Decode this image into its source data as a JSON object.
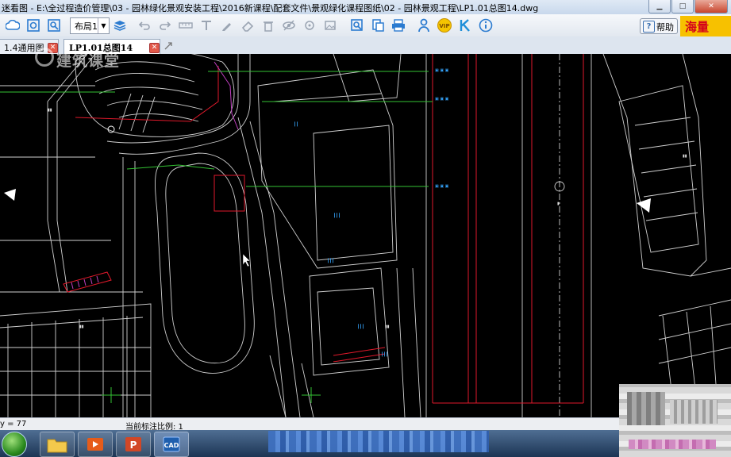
{
  "window": {
    "title": "迷看图 - E:\\全过程造价管理\\03 - 园林绿化景观安装工程\\2016新课程\\配套文件\\景观绿化课程图纸\\02 - 园林景观工程\\LP1.01总图14.dwg"
  },
  "toolbar": {
    "layout_value": "布局1",
    "help_label": "帮助",
    "ad_text": "海量"
  },
  "tabs": [
    {
      "label": "1.4通用图"
    },
    {
      "label": "LP1.01总图14"
    }
  ],
  "watermark": {
    "text": "建筑课堂"
  },
  "status": {
    "coord": "y = 77",
    "scale": "当前标注比例: 1"
  },
  "colors": {
    "cad_background": "#000000",
    "white_lines": "#d8d8d8",
    "red_lines": "#e0192b",
    "green_lines": "#33c233",
    "cyan_text": "#35a6ff",
    "purple_hatch": "#c040c0"
  },
  "icons": {
    "toolbar": [
      "cloud-icon",
      "zoom-extents-icon",
      "zoom-window-icon",
      "layers-icon",
      "undo-icon",
      "redo-icon",
      "dimension-icon",
      "text-icon",
      "pen-icon",
      "eraser-icon",
      "trash-icon",
      "hide-icon",
      "measure-icon",
      "image-icon",
      "find-icon",
      "export-icon",
      "print-icon",
      "user-icon",
      "vip-icon",
      "brand-icon",
      "info-icon"
    ]
  }
}
